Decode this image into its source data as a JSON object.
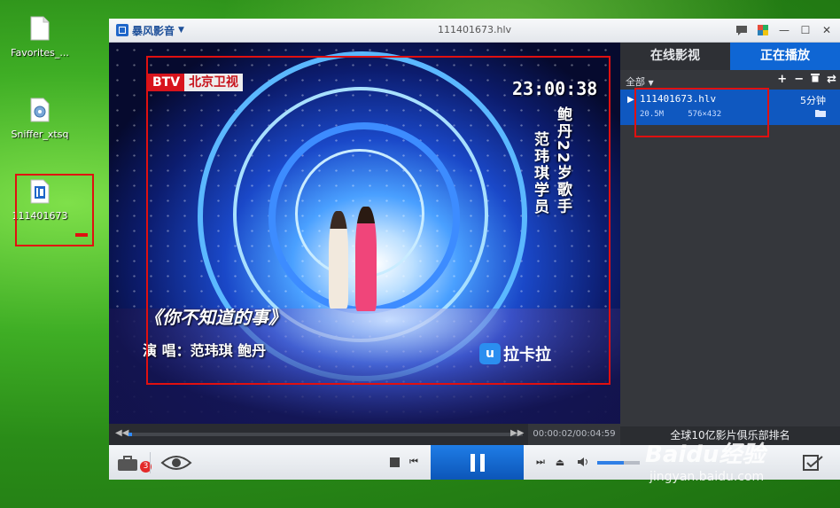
{
  "desktop": {
    "icons": [
      {
        "label": "Favorites_..."
      },
      {
        "label": "Sniffer_xtsq"
      },
      {
        "label": "111401673"
      }
    ]
  },
  "window": {
    "app_name": "暴风影音",
    "title": "111401673.hlv"
  },
  "video": {
    "channel_logo_a": "BTV",
    "channel_logo_b": "北京卫视",
    "clock": "23:00:38",
    "side_caption_1": "鲍丹22岁歌手",
    "side_caption_2": "范玮琪学员",
    "song_title": "《你不知道的事》",
    "singers_line": "演  唱：范玮琪  鲍丹",
    "overlay_badge": "u",
    "overlay_logo": "拉卡拉"
  },
  "seek": {
    "time": "00:00:02/00:04:59",
    "progress_fraction": 0.007
  },
  "panel": {
    "tab_online": "在线影视",
    "tab_now": "正在播放",
    "filter": "全部",
    "item": {
      "name": "111401673.hlv",
      "duration": "5分钟",
      "size": "20.5M",
      "resolution": "576×432"
    },
    "footer": "全球10亿影片俱乐部排名"
  },
  "controls": {
    "notification_count": "3",
    "volume_fraction": 0.62
  },
  "watermark": {
    "text": "Baidu经验",
    "sub": "jingyan.baidu.com"
  }
}
